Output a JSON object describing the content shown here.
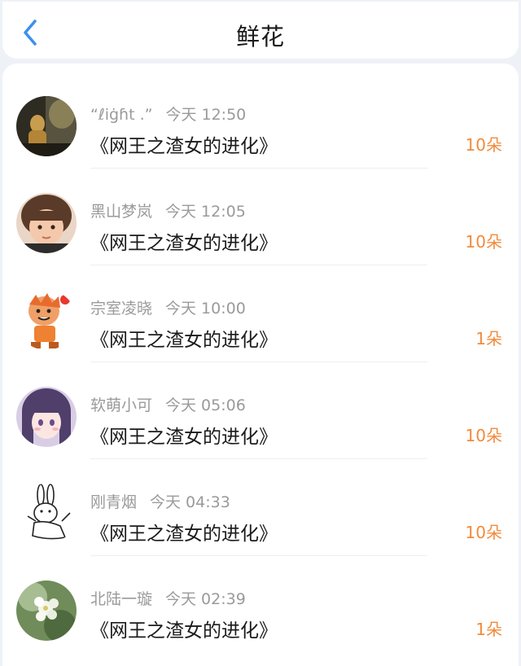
{
  "header": {
    "title": "鲜花",
    "back_icon": "chevron-left-icon",
    "accent_color": "#3a8ff0"
  },
  "amount_color": "#f28a3c",
  "items": [
    {
      "user": "“ℓiġɦt .”",
      "time": "今天 12:50",
      "book": "《网王之渣女的进化》",
      "amount": "10朵"
    },
    {
      "user": "黑山梦岚",
      "time": "今天 12:05",
      "book": "《网王之渣女的进化》",
      "amount": "10朵"
    },
    {
      "user": "宗室凌晓",
      "time": "今天 10:00",
      "book": "《网王之渣女的进化》",
      "amount": "1朵"
    },
    {
      "user": "软萌小可",
      "time": "今天 05:06",
      "book": "《网王之渣女的进化》",
      "amount": "10朵"
    },
    {
      "user": "刚青烟",
      "time": "今天 04:33",
      "book": "《网王之渣女的进化》",
      "amount": "10朵"
    },
    {
      "user": "北陆一璇",
      "time": "今天 02:39",
      "book": "《网王之渣女的进化》",
      "amount": "1朵"
    }
  ]
}
